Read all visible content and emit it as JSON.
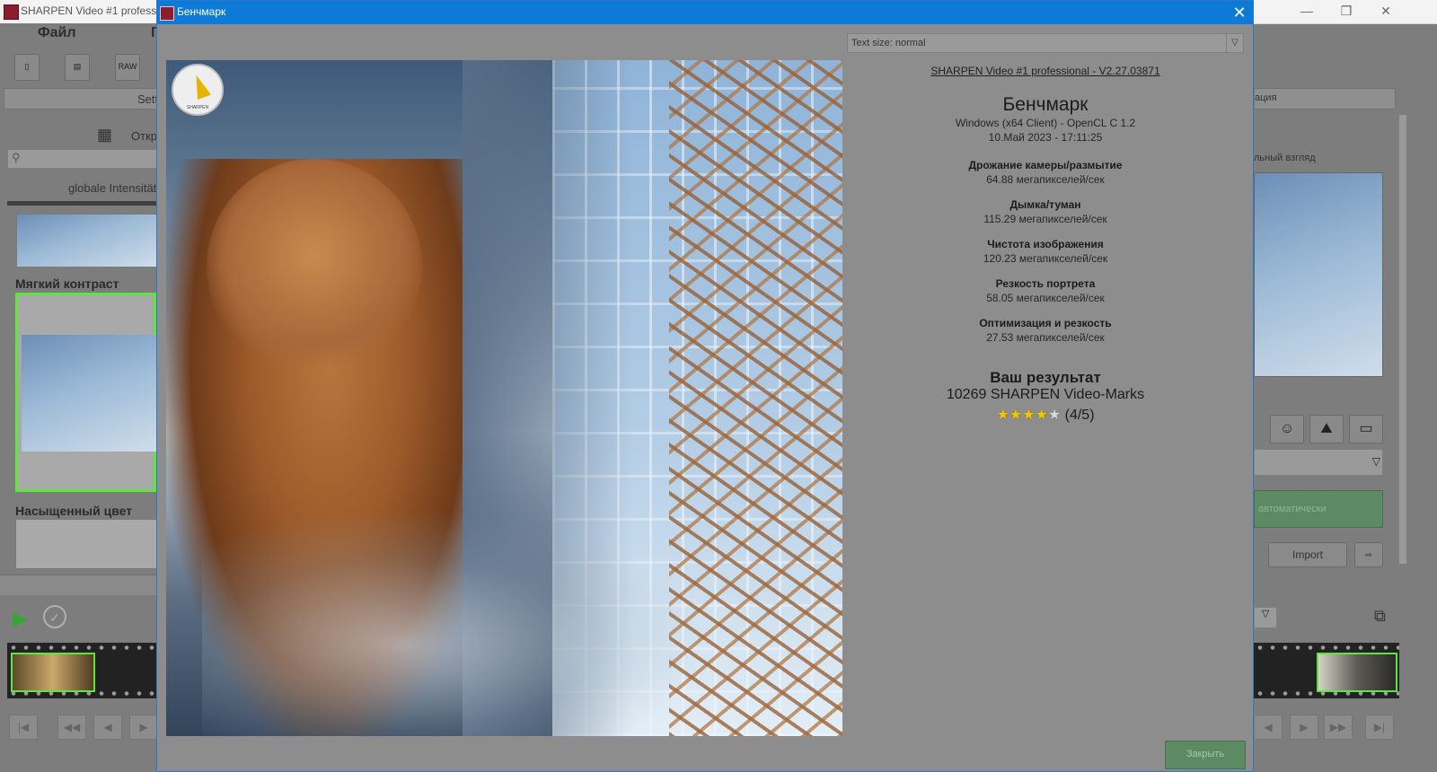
{
  "app": {
    "title": "SHARPEN Video #1 professio",
    "menu": {
      "file": "Файл",
      "second": "Г"
    },
    "tool_raw": "RAW"
  },
  "left": {
    "settings_tab": "Sett",
    "open_label": "Откр",
    "intensity_label": "globale Intensität",
    "section1": "Мягкий контраст",
    "section2": "Насыщенный цвет"
  },
  "right": {
    "tab_fragment": "ация",
    "view_label": "льный взгляд",
    "auto_label": "автоматически",
    "import_label": "Import"
  },
  "dialog": {
    "title": "Бенчмарк",
    "close_symbol": "✕",
    "text_size": "Text size: normal",
    "dropdown_arrow": "▽",
    "compass_caption": "SHARPEN",
    "version_link": "SHARPEN Video #1 professional - V2.27.03871",
    "heading": "Бенчмарк",
    "system": "Windows (x64 Client) - OpenCL C 1.2",
    "datetime": "10.Май 2023 - 17:11:25",
    "metrics": [
      {
        "label": "Дрожание камеры/размытие",
        "value": "64.88 мегапикселей/сек"
      },
      {
        "label": "Дымка/туман",
        "value": "115.29 мегапикселей/сек"
      },
      {
        "label": "Чистота изображения",
        "value": "120.23 мегапикселей/сек"
      },
      {
        "label": "Резкость портрета",
        "value": "58.05 мегапикселей/сек"
      },
      {
        "label": "Оптимизация и резкость",
        "value": "27.53 мегапикселей/сек"
      }
    ],
    "result_title": "Ваш результат",
    "score": "10269 SHARPEN Video-Marks",
    "stars_full": "★★★★",
    "stars_empty": "★",
    "rating": "(4/5)",
    "rating_value": 4,
    "rating_max": 5,
    "close_button": "Закрыть"
  },
  "colors": {
    "dialog_titlebar": "#0c7ad6",
    "selection_border": "#5ee63c",
    "star": "#f2c500",
    "close_button": "#5c8a63"
  }
}
